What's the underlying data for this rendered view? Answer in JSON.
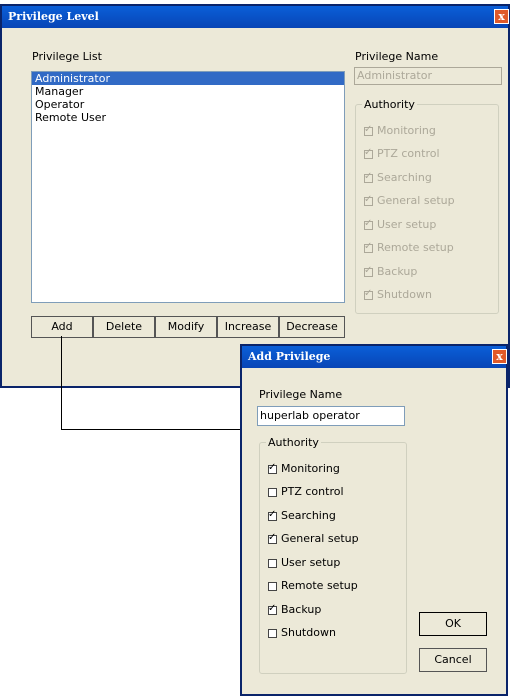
{
  "main_window": {
    "title": "Privilege Level",
    "close_glyph": "x",
    "privilege_list_label": "Privilege List",
    "privilege_list": [
      {
        "label": "Administrator",
        "selected": true
      },
      {
        "label": "Manager",
        "selected": false
      },
      {
        "label": "Operator",
        "selected": false
      },
      {
        "label": "Remote User",
        "selected": false
      }
    ],
    "privilege_name_label": "Privilege Name",
    "privilege_name_value": "Administrator",
    "authority_label": "Authority",
    "authority": [
      {
        "label": "Monitoring",
        "checked": true
      },
      {
        "label": "PTZ control",
        "checked": true
      },
      {
        "label": "Searching",
        "checked": true
      },
      {
        "label": "General setup",
        "checked": true
      },
      {
        "label": "User setup",
        "checked": true
      },
      {
        "label": "Remote setup",
        "checked": true
      },
      {
        "label": "Backup",
        "checked": true
      },
      {
        "label": "Shutdown",
        "checked": true
      }
    ],
    "buttons": {
      "add": "Add",
      "delete": "Delete",
      "modify": "Modify",
      "increase": "Increase",
      "decrease": "Decrease"
    }
  },
  "add_dialog": {
    "title": "Add Privilege",
    "close_glyph": "x",
    "privilege_name_label": "Privilege Name",
    "privilege_name_value": "huperlab operator",
    "authority_label": "Authority",
    "authority": [
      {
        "label": "Monitoring",
        "checked": true
      },
      {
        "label": "PTZ control",
        "checked": false
      },
      {
        "label": "Searching",
        "checked": true
      },
      {
        "label": "General setup",
        "checked": true
      },
      {
        "label": "User setup",
        "checked": false
      },
      {
        "label": "Remote setup",
        "checked": false
      },
      {
        "label": "Backup",
        "checked": true
      },
      {
        "label": "Shutdown",
        "checked": false
      }
    ],
    "buttons": {
      "ok": "OK",
      "cancel": "Cancel"
    }
  },
  "colors": {
    "titlebar": "#0845b6",
    "dialog_bg": "#ece9d8",
    "selection": "#316ac5",
    "close_button": "#e05a2a"
  }
}
